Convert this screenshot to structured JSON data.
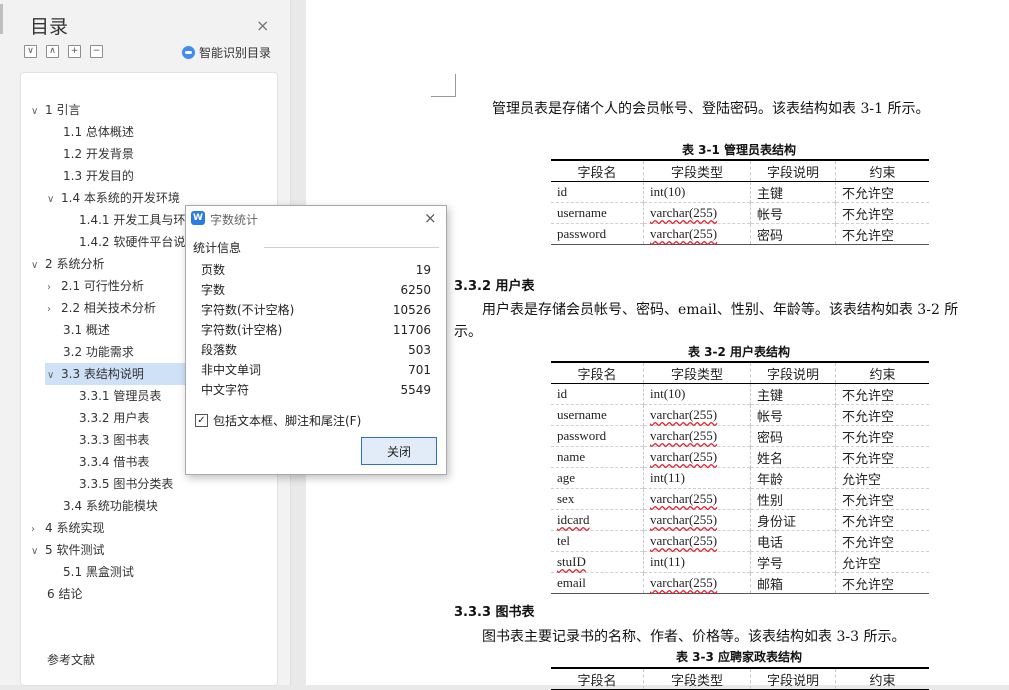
{
  "toc": {
    "title": "目录",
    "close_icon": "×",
    "tools": [
      "∨",
      "∧",
      "+",
      "−"
    ],
    "smart_label": "智能识别目录",
    "items": [
      {
        "chev": "∨",
        "label": "1   引言"
      },
      {
        "chev": "",
        "label": "1.1   总体概述"
      },
      {
        "chev": "",
        "label": "1.2   开发背景"
      },
      {
        "chev": "",
        "label": "1.3   开发目的"
      },
      {
        "chev": "∨",
        "label": "1.4   本系统的开发环境"
      },
      {
        "chev": "",
        "label": "1.4.1   开发工具与环"
      },
      {
        "chev": "",
        "label": "1.4.2   软硬件平台说"
      },
      {
        "chev": "∨",
        "label": "2   系统分析"
      },
      {
        "chev": "›",
        "label": "2.1   可行性分析"
      },
      {
        "chev": "›",
        "label": "2.2   相关技术分析"
      },
      {
        "chev": "",
        "label": "3.1    概述"
      },
      {
        "chev": "",
        "label": "3.2   功能需求"
      },
      {
        "chev": "∨",
        "label": "3.3   表结构说明"
      },
      {
        "chev": "",
        "label": "3.3.1   管理员表"
      },
      {
        "chev": "",
        "label": "3.3.2   用户表"
      },
      {
        "chev": "",
        "label": "3.3.3   图书表"
      },
      {
        "chev": "",
        "label": "3.3.4   借书表"
      },
      {
        "chev": "",
        "label": "3.3.5   图书分类表"
      },
      {
        "chev": "",
        "label": "3.4   系统功能模块"
      },
      {
        "chev": "›",
        "label": "4   系统实现"
      },
      {
        "chev": "∨",
        "label": "5   软件测试"
      },
      {
        "chev": "",
        "label": "5.1  黑盒测试"
      },
      {
        "chev": "",
        "label": "6   结论"
      },
      {
        "chev": "",
        "label": "参考文献"
      }
    ]
  },
  "doc": {
    "p1": "管理员表是存储个人的会员帐号、登陆密码。该表结构如表 3-1 所示。",
    "cap1": "表 3-1  管理员表结构",
    "headers": [
      "字段名",
      "字段类型",
      "字段说明",
      "约束"
    ],
    "t1_rows": [
      [
        "id",
        "int(10)",
        "主键",
        "不允许空"
      ],
      [
        "username",
        "varchar(255)",
        "帐号",
        "不允许空"
      ],
      [
        "password",
        "varchar(255)",
        "密码",
        "不允许空"
      ]
    ],
    "h332": "3.3.2   用户表",
    "p2a": "用户表是存储会员帐号、密码、email、性别、年龄等。该表结构如表 3-2 所",
    "p2b": "示。",
    "cap2": "表 3-2  用户表结构",
    "t2_rows": [
      [
        "id",
        "int(10)",
        "主键",
        "不允许空"
      ],
      [
        "username",
        "varchar(255)",
        "帐号",
        "不允许空"
      ],
      [
        "password",
        "varchar(255)",
        "密码",
        "不允许空"
      ],
      [
        "name",
        "varchar(255)",
        "姓名",
        "不允许空"
      ],
      [
        "age",
        "int(11)",
        "年龄",
        "允许空"
      ],
      [
        "sex",
        "varchar(255)",
        "性别",
        "不允许空"
      ],
      [
        "idcard",
        "varchar(255)",
        "身份证",
        "不允许空"
      ],
      [
        "tel",
        "varchar(255)",
        "电话",
        "不允许空"
      ],
      [
        "stuID",
        "int(11)",
        "学号",
        "允许空"
      ],
      [
        "email",
        "varchar(255)",
        "邮箱",
        "不允许空"
      ]
    ],
    "h333": "3.3.3   图书表",
    "p3": "图书表主要记录书的名称、作者、价格等。该表结构如表 3-3 所示。",
    "cap3": "表 3-3 应聘家政表结构"
  },
  "dialog": {
    "title": "字数统计",
    "logo": "W",
    "close_icon": "×",
    "section": "统计信息",
    "stats": [
      {
        "label": "页数",
        "value": "19"
      },
      {
        "label": "字数",
        "value": "6250"
      },
      {
        "label": "字符数(不计空格)",
        "value": "10526"
      },
      {
        "label": "字符数(计空格)",
        "value": "11706"
      },
      {
        "label": "段落数",
        "value": "503"
      },
      {
        "label": "非中文单词",
        "value": "701"
      },
      {
        "label": "中文字符",
        "value": "5549"
      }
    ],
    "checkbox_mark": "✓",
    "checkbox_label": "包括文本框、脚注和尾注(F)",
    "close_button": "关闭"
  }
}
